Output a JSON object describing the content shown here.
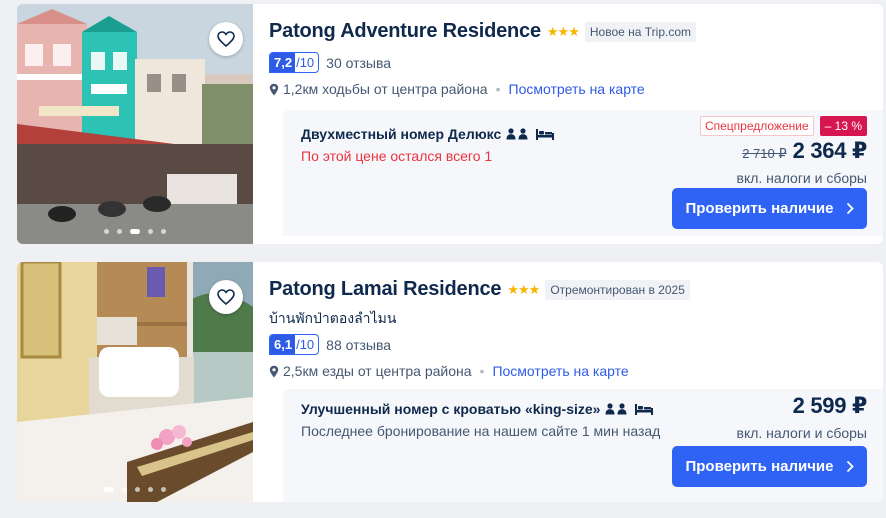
{
  "hotels": [
    {
      "name": "Patong Adventure Residence",
      "stars": "★★★",
      "tag": "Новое на Trip.com",
      "subtitle": "",
      "score": "7,2",
      "score_max": "/10",
      "reviews": "30 отзыва",
      "distance": "1,2км ходьбы от центра района",
      "map_link": "Посмотреть на карте",
      "room_name": "Двухместный номер Делюкс",
      "room_note": "По этой цене остался всего 1",
      "deal_label": "Спецпредложение",
      "deal_pct": "– 13 %",
      "old_price": "2 710 ₽",
      "price": "2 364 ₽",
      "taxes": "вкл. налоги и сборы",
      "button": "Проверить наличие",
      "photo_dots": 5,
      "photo_active": 3
    },
    {
      "name": "Patong Lamai Residence",
      "stars": "★★★",
      "tag": "Отремонтирован в 2025",
      "subtitle": "บ้านพักป่าตองลำไมน",
      "score": "6,1",
      "score_max": "/10",
      "reviews": "88 отзыва",
      "distance": "2,5км езды от центра района",
      "map_link": "Посмотреть на карте",
      "room_name": "Улучшенный номер с кроватью «king-size»",
      "room_note": "Последнее бронирование на нашем сайте 1 мин назад",
      "price": "2 599 ₽",
      "taxes": "вкл. налоги и сборы",
      "button": "Проверить наличие",
      "photo_dots": 5,
      "photo_active": 1
    }
  ],
  "icons": {
    "favorite": "heart-icon",
    "location": "location-pin-icon",
    "guests": "two-guests-icon",
    "bed": "bed-icon",
    "chevron": "chevron-right-icon"
  },
  "colors": {
    "accent": "#2f63f5",
    "score_bg": "#2e5be6",
    "deal": "#d6174f",
    "alert": "#eb333f",
    "star": "#f7b500"
  }
}
